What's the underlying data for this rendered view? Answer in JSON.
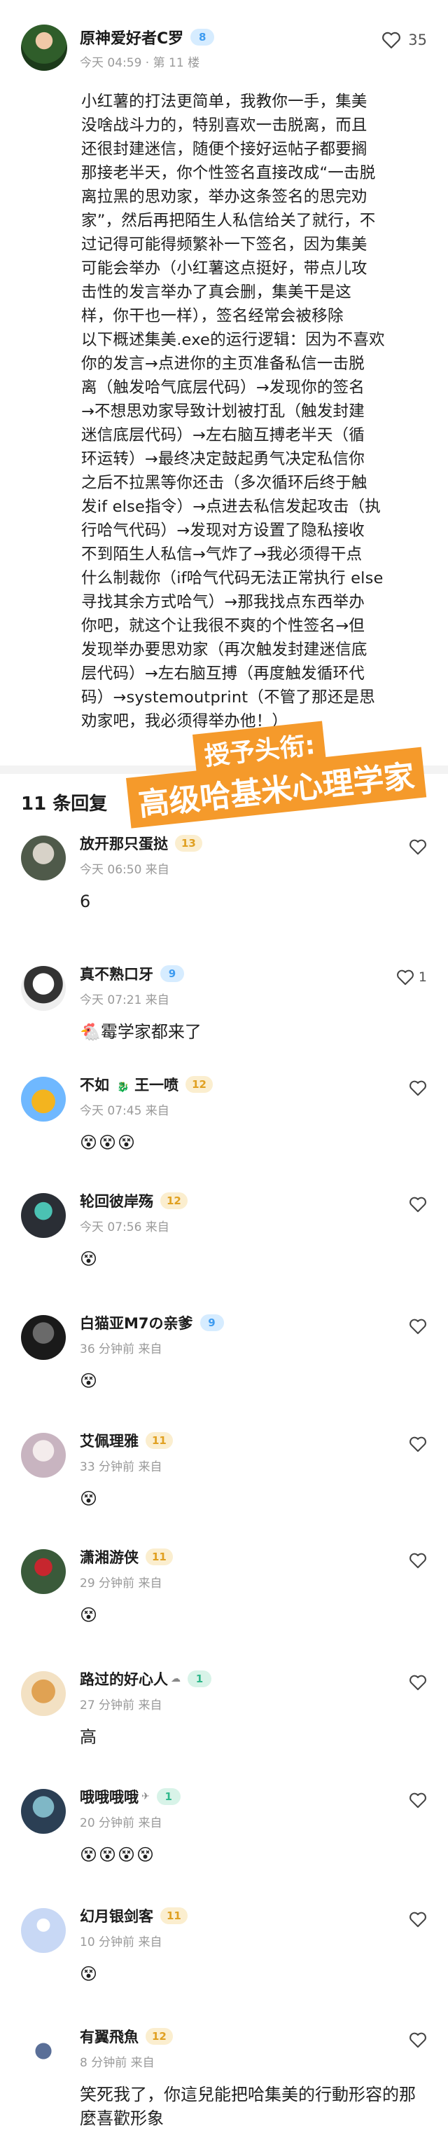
{
  "post": {
    "username": "原神爱好者C罗",
    "level": "8",
    "time": "今天 04:59",
    "floor": "第 11 楼",
    "likes": "35",
    "body": [
      "小红薯的打法更简单，我教你一手，集美",
      "没啥战斗力的，特别喜欢一击脱离，而且",
      "还很封建迷信，随便个接好运帖子都要搁",
      "那接老半天，你个性签名直接改成“一击脱",
      "离拉黑的思劝家，举办这条签名的思完劝",
      "家”，然后再把陌生人私信给关了就行，不",
      "过记得可能得频繁补一下签名，因为集美",
      "可能会举办（小红薯这点挺好，带点儿攻",
      "击性的发言举办了真会删，集美干是这",
      "样，你干也一样），签名经常会被移除",
      "以下概述集美.exe的运行逻辑：因为不喜欢",
      "你的发言→点进你的主页准备私信一击脱",
      "离（触发哈气底层代码）→发现你的签名",
      "→不想思劝家导致计划被打乱（触发封建",
      "迷信底层代码）→左右脑互搏老半天（循",
      "环运转）→最终决定鼓起勇气决定私信你",
      "之后不拉黑等你还击（多次循环后终于触",
      "发if else指令）→点进去私信发起攻击（执",
      "行哈气代码）→发现对方设置了隐私接收",
      "不到陌生人私信→气炸了→我必须得干点",
      "什么制裁你（if哈气代码无法正常执行 else",
      "寻找其余方式哈气）→那我找点东西举办",
      "你吧，就这个让我很不爽的个性签名→但",
      "发现举办要思劝家（再次触发封建迷信底",
      "层代码）→左右脑互搏（再度触发循环代",
      "码）→systemoutprint（不管了那还是思",
      "劝家吧，我必须得举办他！）"
    ]
  },
  "comments_header": {
    "count_label": "11 条回复"
  },
  "overlay": {
    "line1": "授予头衔:",
    "line2": "高级哈基米心理学家"
  },
  "comments": [
    {
      "name": "放开那只蛋挞",
      "level": "13",
      "time": "今天 06:50 来自",
      "text": "6",
      "likes": ""
    },
    {
      "name": "真不熟口牙",
      "level": "9",
      "time": "今天 07:21 来自",
      "text": "🐔霉学家都来了",
      "likes": "1"
    },
    {
      "name": "不如 ",
      "name2": "王一喷",
      "level": "12",
      "time": "今天 07:45 来自",
      "text": "😵😵😵",
      "likes": ""
    },
    {
      "name": "轮回彼岸殇",
      "level": "12",
      "time": "今天 07:56 来自",
      "text": "😵",
      "likes": ""
    },
    {
      "name": "白猫亚M7の亲爹",
      "level": "9",
      "time": "36 分钟前 来自",
      "text": "😵",
      "likes": ""
    },
    {
      "name": "艾佩理雅",
      "level": "11",
      "time": "33 分钟前 来自",
      "text": "😵",
      "likes": ""
    },
    {
      "name": "潇湘游侠",
      "level": "11",
      "time": "29 分钟前 来自",
      "text": "😵",
      "likes": ""
    },
    {
      "name": "路过的好心人",
      "level": "1",
      "time": "27 分钟前 来自",
      "text": "高",
      "likes": ""
    },
    {
      "name": "哦哦哦哦",
      "level": "1",
      "time": "20 分钟前 来自",
      "text": "😵😵😵😵",
      "likes": ""
    },
    {
      "name": "幻月银剑客",
      "level": "11",
      "time": "10 分钟前 来自",
      "text": "😵",
      "likes": ""
    },
    {
      "name": "有翼飛魚",
      "level": "12",
      "time": "8 分钟前 来自",
      "text": "笑死我了，你這兒能把哈集美的行動形容的那麼喜歡形象",
      "likes": ""
    }
  ]
}
